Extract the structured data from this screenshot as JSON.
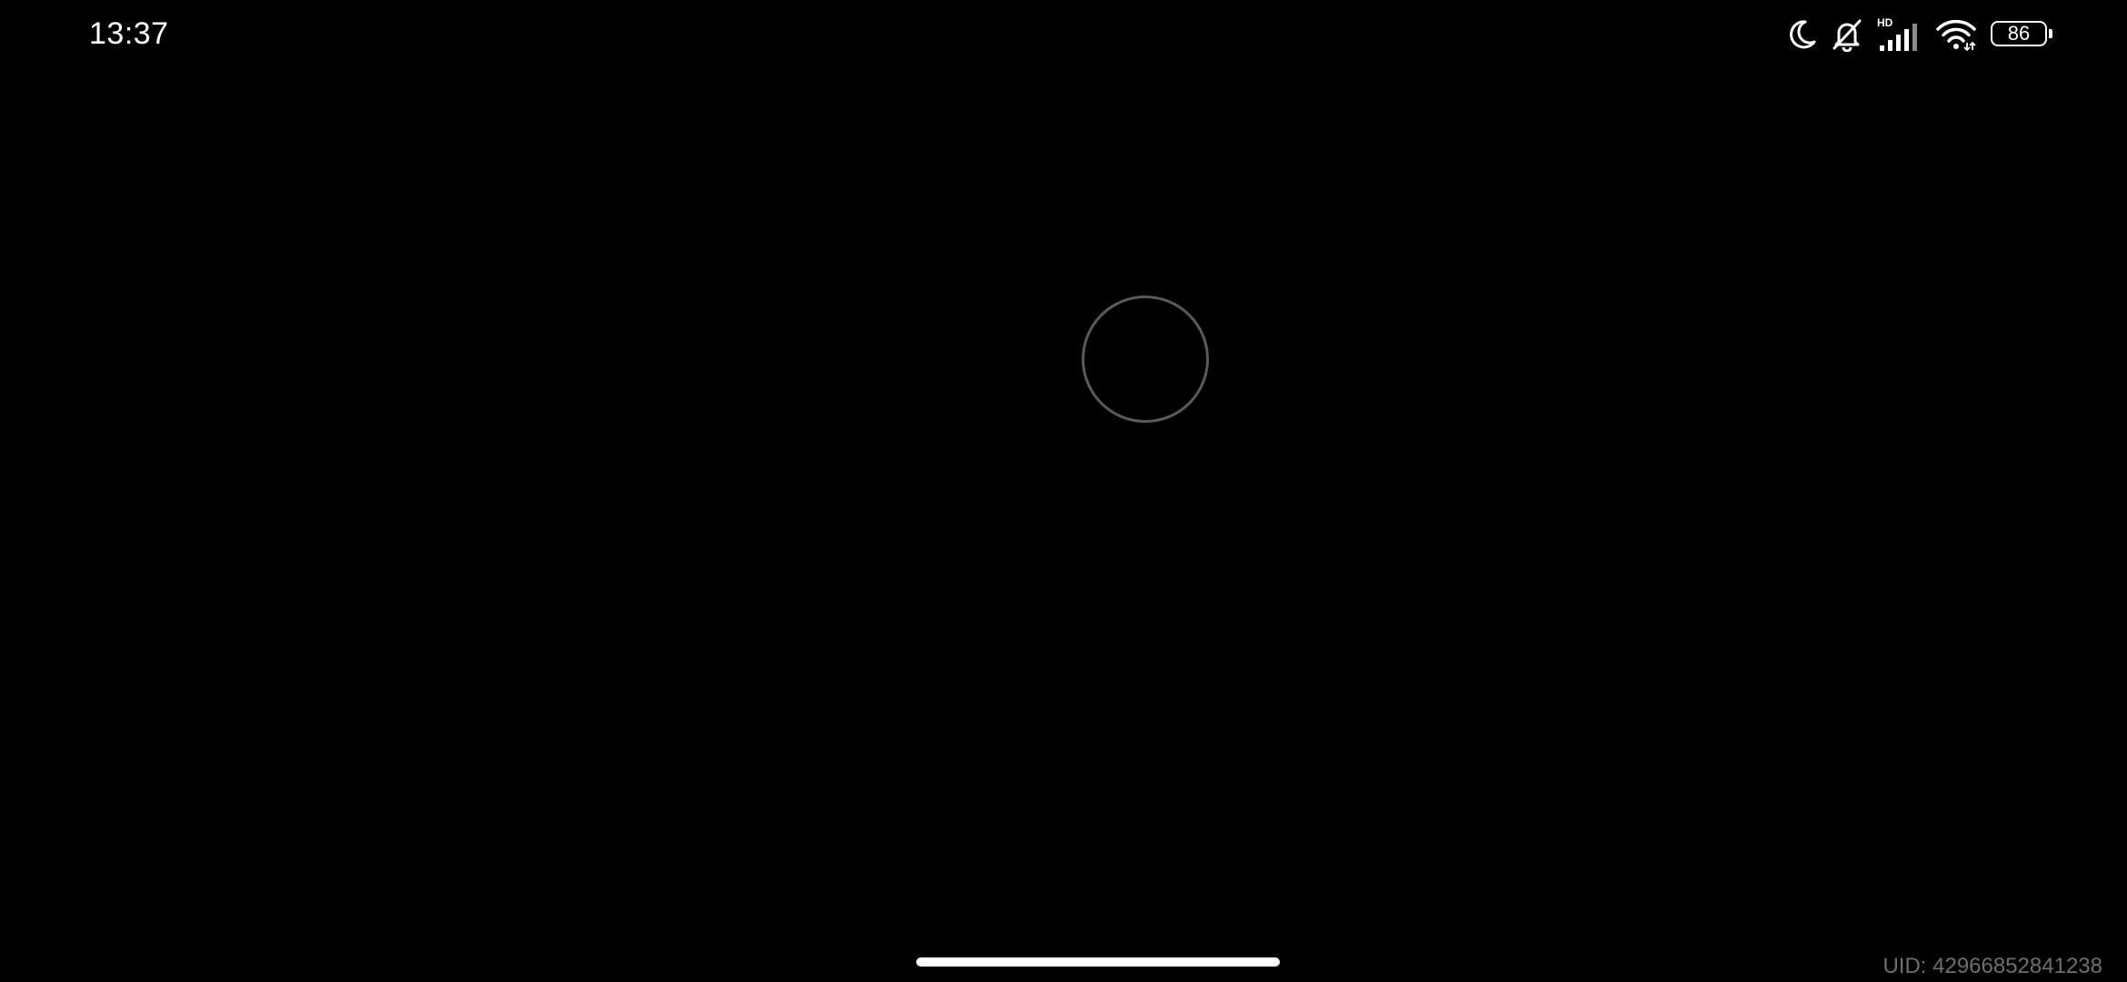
{
  "status_bar": {
    "time": "13:37",
    "icons": [
      "moon-icon",
      "muted-bell-icon",
      "hd-signal-icon",
      "wifi-icon",
      "battery-icon"
    ],
    "signal_label": "HD",
    "battery_level": "86"
  },
  "loading": {
    "icon": "loading-spinner-icon"
  },
  "footer": {
    "uid_text": "UID: 42966852841238"
  },
  "colors": {
    "background": "#000000",
    "status_text": "#ffffff",
    "spinner_ring": "#5a5a5a",
    "uid_text": "#6f6f6f"
  }
}
